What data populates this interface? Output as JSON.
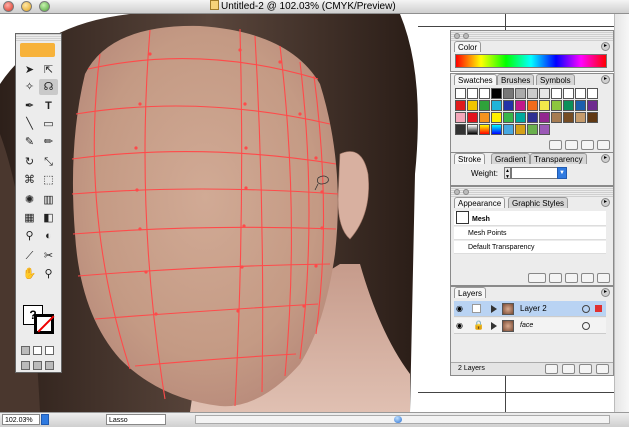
{
  "window": {
    "title": "Untitled-2 @ 102.03% (CMYK/Preview)"
  },
  "status_bar": {
    "zoom": "102.03%",
    "current_tool": "Lasso"
  },
  "panels": {
    "color": {
      "tab": "Color"
    },
    "swatches": {
      "tabs": [
        "Swatches",
        "Brushes",
        "Symbols"
      ]
    },
    "stroke": {
      "tabs": [
        "Stroke",
        "Gradient",
        "Transparency"
      ],
      "weight_label": "Weight:",
      "weight_value": ""
    },
    "appearance": {
      "tabs": [
        "Appearance",
        "Graphic Styles"
      ],
      "rows": [
        "Mesh",
        "Mesh Points",
        "Default Transparency"
      ]
    },
    "layers": {
      "tab": "Layers",
      "items": [
        "Layer 2",
        "face"
      ],
      "footer": "2 Layers"
    }
  },
  "colors": {
    "mesh_stroke": "#ff4a4a",
    "skin": "#c99e88",
    "hair": "#3b2a22",
    "selection": "#b9d3f3"
  }
}
